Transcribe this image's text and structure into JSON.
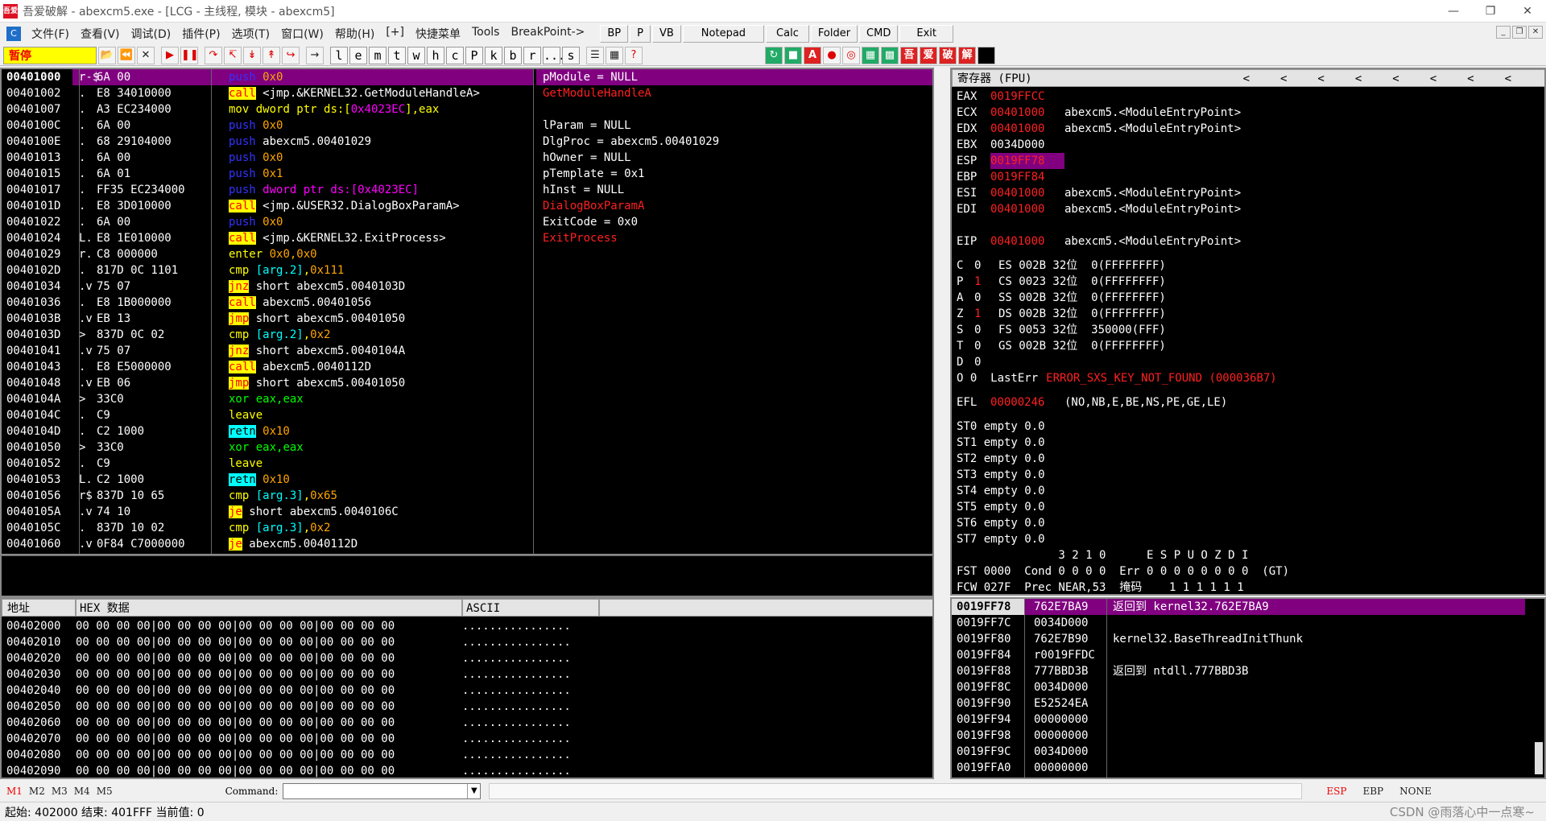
{
  "title": "吾爱破解 - abexcm5.exe - [LCG - 主线程, 模块 - abexcm5]",
  "app_icon": "吾爱",
  "menu": [
    "文件(F)",
    "查看(V)",
    "调试(D)",
    "插件(P)",
    "选项(T)",
    "窗口(W)",
    "帮助(H)",
    "[+]",
    "快捷菜单",
    "Tools",
    "BreakPoint->"
  ],
  "plugin_buttons": [
    "BP",
    "P",
    "VB",
    "Notepad",
    "Calc",
    "Folder",
    "CMD",
    "Exit"
  ],
  "status": "暂停",
  "letters": [
    "l",
    "e",
    "m",
    "t",
    "w",
    "h",
    "c",
    "P",
    "k",
    "b",
    "r",
    "...",
    "s"
  ],
  "disasm": [
    {
      "addr": "00401000",
      "m": "r-$",
      "hex": "6A 00",
      "ins": [
        [
          "blu",
          "push"
        ],
        [
          "org",
          " 0x0"
        ]
      ],
      "sel": true
    },
    {
      "addr": "00401002",
      "m": ".",
      "hex": "E8 34010000",
      "ins": [
        [
          "b-call",
          "call"
        ],
        [
          "wht",
          " <jmp.&KERNEL32.GetModuleHandleA>"
        ]
      ]
    },
    {
      "addr": "00401007",
      "m": ".",
      "hex": "A3 EC234000",
      "ins": [
        [
          "yel",
          "mov"
        ],
        [
          "yel",
          " dword ptr ds:["
        ],
        [
          "mag",
          "0x4023EC"
        ],
        [
          "yel",
          "],eax"
        ]
      ]
    },
    {
      "addr": "0040100C",
      "m": ".",
      "hex": "6A 00",
      "ins": [
        [
          "blu",
          "push"
        ],
        [
          "org",
          " 0x0"
        ]
      ]
    },
    {
      "addr": "0040100E",
      "m": ".",
      "hex": "68 29104000",
      "ins": [
        [
          "blu",
          "push"
        ],
        [
          "wht",
          " abexcm5.00401029"
        ]
      ]
    },
    {
      "addr": "00401013",
      "m": ".",
      "hex": "6A 00",
      "ins": [
        [
          "blu",
          "push"
        ],
        [
          "org",
          " 0x0"
        ]
      ]
    },
    {
      "addr": "00401015",
      "m": ".",
      "hex": "6A 01",
      "ins": [
        [
          "blu",
          "push"
        ],
        [
          "org",
          " 0x1"
        ]
      ]
    },
    {
      "addr": "00401017",
      "m": ".",
      "hex": "FF35 EC234000",
      "ins": [
        [
          "blu",
          "push"
        ],
        [
          "mag",
          " dword ptr ds:[0x4023EC]"
        ]
      ]
    },
    {
      "addr": "0040101D",
      "m": ".",
      "hex": "E8 3D010000",
      "ins": [
        [
          "b-call",
          "call"
        ],
        [
          "wht",
          " <jmp.&USER32.DialogBoxParamA>"
        ]
      ]
    },
    {
      "addr": "00401022",
      "m": ".",
      "hex": "6A 00",
      "ins": [
        [
          "blu",
          "push"
        ],
        [
          "org",
          " 0x0"
        ]
      ]
    },
    {
      "addr": "00401024",
      "m": "L.",
      "hex": "E8 1E010000",
      "ins": [
        [
          "b-call",
          "call"
        ],
        [
          "wht",
          " <jmp.&KERNEL32.ExitProcess>"
        ]
      ]
    },
    {
      "addr": "00401029",
      "m": "r.",
      "hex": "C8 000000",
      "ins": [
        [
          "yel",
          "enter"
        ],
        [
          "org",
          " 0x0,0x0"
        ]
      ]
    },
    {
      "addr": "0040102D",
      "m": ".",
      "hex": "817D 0C 1101",
      "ins": [
        [
          "yel",
          "cmp"
        ],
        [
          "cyn",
          " [arg.2]"
        ],
        [
          "yel",
          ","
        ],
        [
          "org",
          "0x111"
        ]
      ]
    },
    {
      "addr": "00401034",
      "m": ".v",
      "hex": "75 07",
      "ins": [
        [
          "b-jmp",
          "jnz"
        ],
        [
          "wht",
          " short abexcm5.0040103D"
        ]
      ]
    },
    {
      "addr": "00401036",
      "m": ".",
      "hex": "E8 1B000000",
      "ins": [
        [
          "b-call",
          "call"
        ],
        [
          "wht",
          " abexcm5.00401056"
        ]
      ]
    },
    {
      "addr": "0040103B",
      "m": ".v",
      "hex": "EB 13",
      "ins": [
        [
          "b-jmp",
          "jmp"
        ],
        [
          "wht",
          " short abexcm5.00401050"
        ]
      ]
    },
    {
      "addr": "0040103D",
      "m": ">",
      "hex": "837D 0C 02",
      "ins": [
        [
          "yel",
          "cmp"
        ],
        [
          "cyn",
          " [arg.2]"
        ],
        [
          "yel",
          ","
        ],
        [
          "org",
          "0x2"
        ]
      ]
    },
    {
      "addr": "00401041",
      "m": ".v",
      "hex": "75 07",
      "ins": [
        [
          "b-jmp",
          "jnz"
        ],
        [
          "wht",
          " short abexcm5.0040104A"
        ]
      ]
    },
    {
      "addr": "00401043",
      "m": ".",
      "hex": "E8 E5000000",
      "ins": [
        [
          "b-call",
          "call"
        ],
        [
          "wht",
          " abexcm5.0040112D"
        ]
      ]
    },
    {
      "addr": "00401048",
      "m": ".v",
      "hex": "EB 06",
      "ins": [
        [
          "b-jmp",
          "jmp"
        ],
        [
          "wht",
          " short abexcm5.00401050"
        ]
      ]
    },
    {
      "addr": "0040104A",
      "m": ">",
      "hex": "33C0",
      "ins": [
        [
          "grn",
          "xor"
        ],
        [
          "grn",
          " eax,eax"
        ]
      ]
    },
    {
      "addr": "0040104C",
      "m": ".",
      "hex": "C9",
      "ins": [
        [
          "yel",
          "leave"
        ]
      ]
    },
    {
      "addr": "0040104D",
      "m": ".",
      "hex": "C2 1000",
      "ins": [
        [
          "b-retn",
          "retn"
        ],
        [
          "org",
          " 0x10"
        ]
      ]
    },
    {
      "addr": "00401050",
      "m": ">",
      "hex": "33C0",
      "ins": [
        [
          "grn",
          "xor"
        ],
        [
          "grn",
          " eax,eax"
        ]
      ]
    },
    {
      "addr": "00401052",
      "m": ".",
      "hex": "C9",
      "ins": [
        [
          "yel",
          "leave"
        ]
      ]
    },
    {
      "addr": "00401053",
      "m": "L.",
      "hex": "C2 1000",
      "ins": [
        [
          "b-retn",
          "retn"
        ],
        [
          "org",
          " 0x10"
        ]
      ]
    },
    {
      "addr": "00401056",
      "m": "r$",
      "hex": "837D 10 65",
      "ins": [
        [
          "yel",
          "cmp"
        ],
        [
          "cyn",
          " [arg.3]"
        ],
        [
          "yel",
          ","
        ],
        [
          "org",
          "0x65"
        ]
      ]
    },
    {
      "addr": "0040105A",
      "m": ".v",
      "hex": "74 10",
      "ins": [
        [
          "b-jmp",
          "je"
        ],
        [
          "wht",
          " short abexcm5.0040106C"
        ]
      ]
    },
    {
      "addr": "0040105C",
      "m": ".",
      "hex": "837D 10 02",
      "ins": [
        [
          "yel",
          "cmp"
        ],
        [
          "cyn",
          " [arg.3]"
        ],
        [
          "yel",
          ","
        ],
        [
          "org",
          "0x2"
        ]
      ]
    },
    {
      "addr": "00401060",
      "m": ".v",
      "hex": "0F84 C7000000",
      "ins": [
        [
          "b-jmp",
          "je"
        ],
        [
          "wht",
          " abexcm5.0040112D"
        ]
      ]
    }
  ],
  "comments": [
    {
      "t": "pModule = NULL",
      "c": "wht",
      "sel": true
    },
    {
      "t": "GetModuleHandleA",
      "c": "red"
    },
    {
      "t": "",
      "c": "wht"
    },
    {
      "t": "lParam = NULL",
      "c": "wht"
    },
    {
      "t": "DlgProc = abexcm5.00401029",
      "c": "wht"
    },
    {
      "t": "hOwner = NULL",
      "c": "wht"
    },
    {
      "t": "pTemplate = 0x1",
      "c": "wht"
    },
    {
      "t": "hInst = NULL",
      "c": "wht"
    },
    {
      "t": "DialogBoxParamA",
      "c": "red"
    },
    {
      "t": "ExitCode = 0x0",
      "c": "wht"
    },
    {
      "t": "ExitProcess",
      "c": "red"
    }
  ],
  "registers_title": "寄存器 (FPU)",
  "registers": [
    {
      "n": "EAX",
      "v": "0019FFCC",
      "vc": "red",
      "d": ""
    },
    {
      "n": "ECX",
      "v": "00401000",
      "vc": "red",
      "d": "abexcm5.<ModuleEntryPoint>"
    },
    {
      "n": "EDX",
      "v": "00401000",
      "vc": "red",
      "d": "abexcm5.<ModuleEntryPoint>"
    },
    {
      "n": "EBX",
      "v": "0034D000",
      "vc": "wht",
      "d": ""
    },
    {
      "n": "ESP",
      "v": "0019FF78",
      "vc": "esp",
      "d": ""
    },
    {
      "n": "EBP",
      "v": "0019FF84",
      "vc": "red",
      "d": ""
    },
    {
      "n": "ESI",
      "v": "00401000",
      "vc": "red",
      "d": "abexcm5.<ModuleEntryPoint>"
    },
    {
      "n": "EDI",
      "v": "00401000",
      "vc": "red",
      "d": "abexcm5.<ModuleEntryPoint>"
    },
    {
      "n": "",
      "v": "",
      "vc": "wht",
      "d": ""
    },
    {
      "n": "EIP",
      "v": "00401000",
      "vc": "red",
      "d": "abexcm5.<ModuleEntryPoint>"
    }
  ],
  "flags": [
    {
      "f": "C",
      "v": "0",
      "vc": "wht",
      "seg": "ES 002B 32位  0(FFFFFFFF)"
    },
    {
      "f": "P",
      "v": "1",
      "vc": "red",
      "seg": "CS 0023 32位  0(FFFFFFFF)"
    },
    {
      "f": "A",
      "v": "0",
      "vc": "wht",
      "seg": "SS 002B 32位  0(FFFFFFFF)"
    },
    {
      "f": "Z",
      "v": "1",
      "vc": "red",
      "seg": "DS 002B 32位  0(FFFFFFFF)"
    },
    {
      "f": "S",
      "v": "0",
      "vc": "wht",
      "seg": "FS 0053 32位  350000(FFF)"
    },
    {
      "f": "T",
      "v": "0",
      "vc": "wht",
      "seg": "GS 002B 32位  0(FFFFFFFF)"
    },
    {
      "f": "D",
      "v": "0",
      "vc": "wht",
      "seg": ""
    }
  ],
  "lasterr_label": "O 0  LastErr",
  "lasterr_val": "ERROR_SXS_KEY_NOT_FOUND (000036B7)",
  "efl_label": "EFL",
  "efl_val": "00000246",
  "efl_desc": "(NO,NB,E,BE,NS,PE,GE,LE)",
  "fpu": [
    "ST0 empty 0.0",
    "ST1 empty 0.0",
    "ST2 empty 0.0",
    "ST3 empty 0.0",
    "ST4 empty 0.0",
    "ST5 empty 0.0",
    "ST6 empty 0.0",
    "ST7 empty 0.0"
  ],
  "fpu_hdr": "               3 2 1 0      E S P U O Z D I",
  "fst": "FST 0000  Cond 0 0 0 0  Err 0 0 0 0 0 0 0 0  (GT)",
  "fcw": "FCW 027F  Prec NEAR,53  掩码    1 1 1 1 1 1",
  "dump_headers": {
    "addr": "地址",
    "hex": "HEX 数据",
    "ascii": "ASCII"
  },
  "dump": [
    "00402000",
    "00402010",
    "00402020",
    "00402030",
    "00402040",
    "00402050",
    "00402060",
    "00402070",
    "00402080",
    "00402090"
  ],
  "dump_hex": "00 00 00 00|00 00 00 00|00 00 00 00|00 00 00 00",
  "dump_ascii": "................",
  "stack": [
    {
      "a": "0019FF78",
      "v": "762E7BA9",
      "c": "返回到 kernel32.762E7BA9",
      "sel": true
    },
    {
      "a": "0019FF7C",
      "v": "0034D000",
      "c": ""
    },
    {
      "a": "0019FF80",
      "v": "762E7B90",
      "c": "kernel32.BaseThreadInitThunk"
    },
    {
      "a": "0019FF84",
      "v": "r0019FFDC",
      "c": ""
    },
    {
      "a": "0019FF88",
      "v": "777BBD3B",
      "c": "返回到 ntdll.777BBD3B"
    },
    {
      "a": "0019FF8C",
      "v": "0034D000",
      "c": ""
    },
    {
      "a": "0019FF90",
      "v": "E52524EA",
      "c": ""
    },
    {
      "a": "0019FF94",
      "v": "00000000",
      "c": ""
    },
    {
      "a": "0019FF98",
      "v": "00000000",
      "c": ""
    },
    {
      "a": "0019FF9C",
      "v": "0034D000",
      "c": ""
    },
    {
      "a": "0019FFA0",
      "v": "00000000",
      "c": ""
    }
  ],
  "mem_tabs": [
    "M1",
    "M2",
    "M3",
    "M4",
    "M5"
  ],
  "command_label": "Command:",
  "stack_tabs": [
    "ESP",
    "EBP",
    "NONE"
  ],
  "statusbar": "起始: 402000  结束: 401FFF  当前值: 0",
  "watermark": "CSDN @雨落心中一点寒~"
}
